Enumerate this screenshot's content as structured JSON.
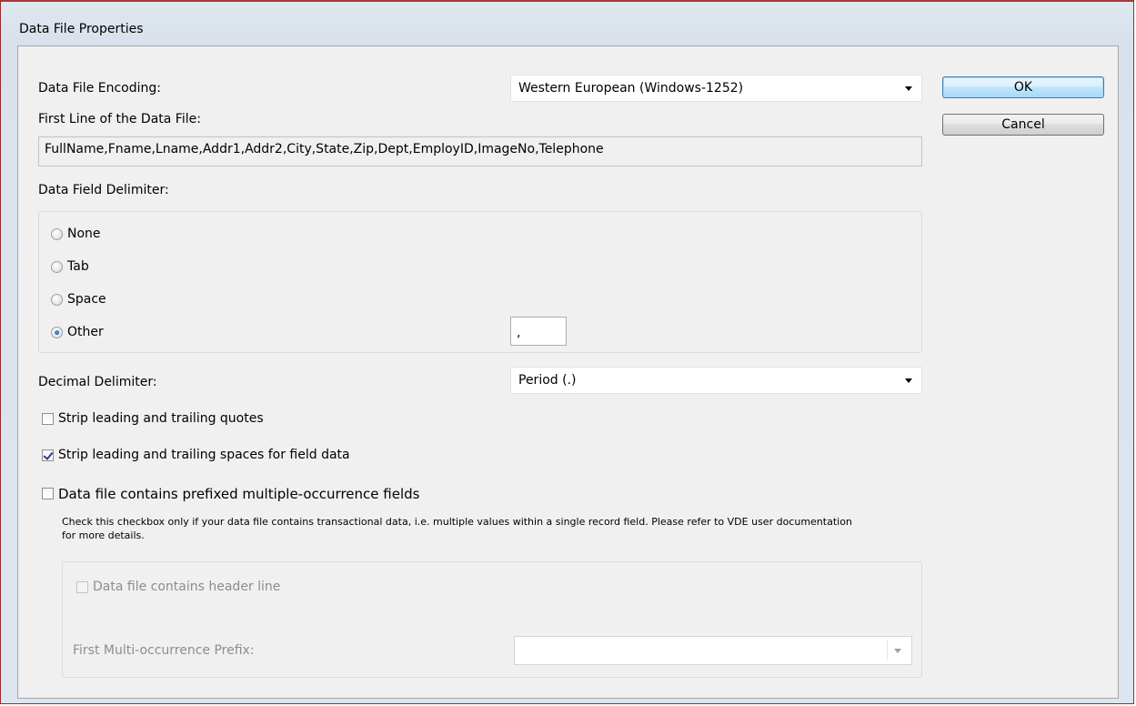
{
  "window": {
    "title": "Data File Properties"
  },
  "encoding": {
    "label": "Data File Encoding:",
    "selected": "Western European (Windows-1252)"
  },
  "first_line": {
    "label": "First Line of the Data File:",
    "value": "FullName,Fname,Lname,Addr1,Addr2,City,State,Zip,Dept,EmployID,ImageNo,Telephone"
  },
  "field_delimiter": {
    "label": "Data Field Delimiter:",
    "options": [
      {
        "label": "None",
        "checked": false
      },
      {
        "label": "Tab",
        "checked": false
      },
      {
        "label": "Space",
        "checked": false
      },
      {
        "label": "Other",
        "checked": true
      }
    ],
    "other_value": ","
  },
  "decimal_delimiter": {
    "label": "Decimal Delimiter:",
    "selected": "Period (.)"
  },
  "checkboxes": {
    "strip_quotes": {
      "label": "Strip leading and trailing quotes",
      "checked": false
    },
    "strip_spaces": {
      "label": "Strip leading and trailing spaces for field data",
      "checked": true
    },
    "multi_occurrence": {
      "label": "Data file contains prefixed multiple-occurrence fields",
      "checked": false
    }
  },
  "multi_occurrence_help": "Check this checkbox only if your data file contains transactional data, i.e. multiple values within a single record field. Please refer to VDE user documentation for more details.",
  "multi_section": {
    "header_line_label": "Data file contains header line",
    "prefix_label": "First Multi-occurrence Prefix:",
    "prefix_value": ""
  },
  "buttons": {
    "ok": "OK",
    "cancel": "Cancel"
  }
}
